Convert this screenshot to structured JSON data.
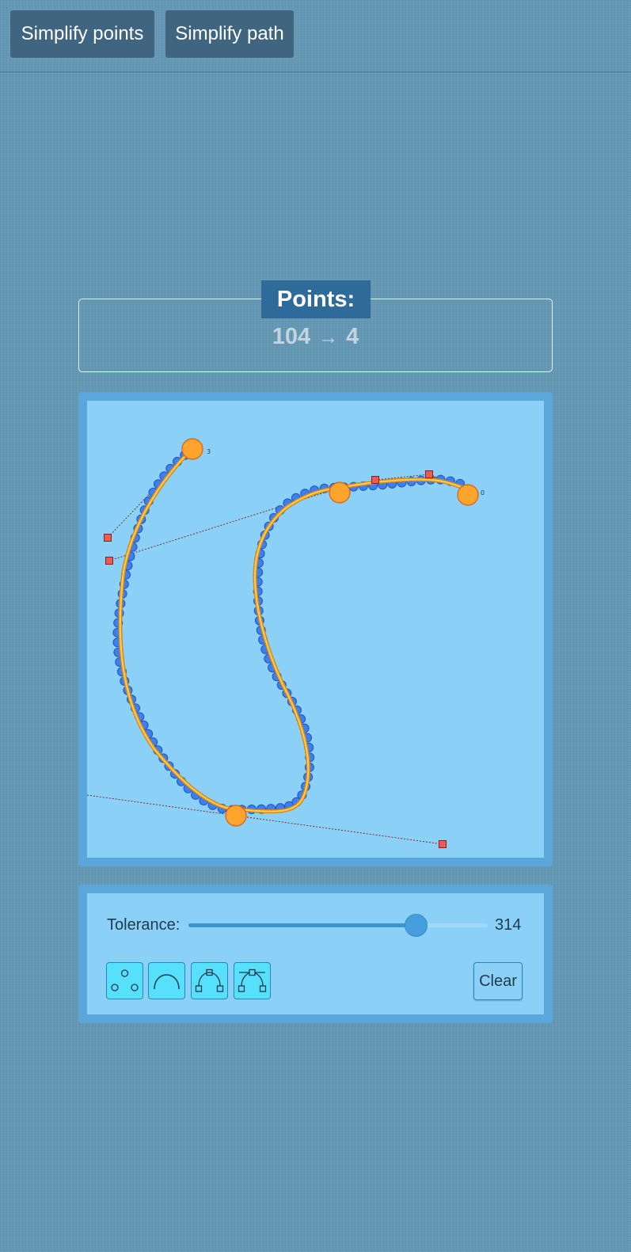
{
  "toolbar": {
    "simplify_points_label": "Simplify points",
    "simplify_path_label": "Simplify path"
  },
  "points_panel": {
    "title": "Points:",
    "original_count": "104",
    "arrow": "→",
    "simplified_count": "4"
  },
  "canvas": {
    "node_labels": [
      "3",
      "0"
    ],
    "colors": {
      "canvas_bg": "#8bd1f7",
      "frame": "#5ba6db",
      "input_point_fill": "#3d7ff0",
      "input_point_stroke": "#1f55c2",
      "curve_outer": "#d98a12",
      "curve_inner": "#ffcf5a",
      "anchor_fill": "#ffa42c",
      "anchor_stroke": "#e05a1a",
      "handle_fill": "#ef5a52",
      "handle_stroke": "#8a1e1e",
      "handle_line": "#7a2a2a"
    }
  },
  "controls": {
    "tolerance_label": "Tolerance:",
    "tolerance_value": "314",
    "tolerance_fraction": 0.76,
    "mode_buttons": [
      {
        "name": "points-mode-icon",
        "active": true
      },
      {
        "name": "arc-mode-icon",
        "active": true
      },
      {
        "name": "bezier-mode-icon",
        "active": true
      },
      {
        "name": "bezier-handles-mode-icon",
        "active": true
      }
    ],
    "clear_label": "Clear"
  }
}
